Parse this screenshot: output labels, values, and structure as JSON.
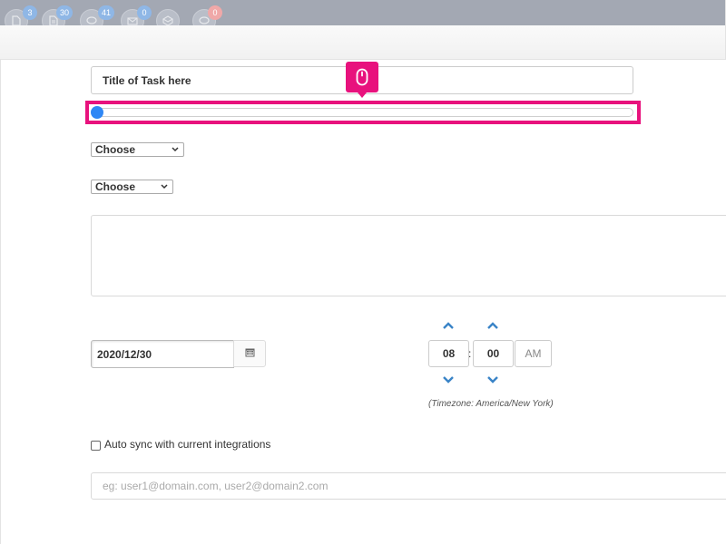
{
  "topbar": {
    "icons": [
      {
        "icon": "document-icon",
        "badge": "3",
        "badge_color": "#8fb7e6"
      },
      {
        "icon": "file-icon",
        "badge": "30",
        "badge_color": "#8fb7e6"
      },
      {
        "icon": "chat-icon",
        "badge": "41",
        "badge_color": "#8fb7e6"
      },
      {
        "icon": "mail-icon",
        "badge": "0",
        "badge_color": "#8fb7e6"
      },
      {
        "icon": "box-icon",
        "badge": "",
        "badge_color": ""
      },
      {
        "icon": "comment-icon",
        "badge": "0",
        "badge_color": "#f0a8a8"
      }
    ]
  },
  "form": {
    "title_value": "Title of Task here",
    "slider_fraction": 0.0,
    "select_1": "Choose",
    "select_2": "Choose",
    "description_value": "",
    "date_value": "2020/12/30",
    "time": {
      "hour": "08",
      "minute": "00",
      "ampm": "AM",
      "separator": ":"
    },
    "timezone_note": "(Timezone: America/New  York)",
    "auto_sync_label": "Auto sync with current integrations",
    "auto_sync_checked": false,
    "email_placeholder": "eg: user1@domain.com, user2@domain2.com"
  },
  "cursor_hint": {
    "icon": "mouse-icon",
    "color": "#e8127d"
  },
  "colors": {
    "accent": "#e8127d",
    "slider": "#2f87f5",
    "time_arrows": "#3a84c7"
  }
}
